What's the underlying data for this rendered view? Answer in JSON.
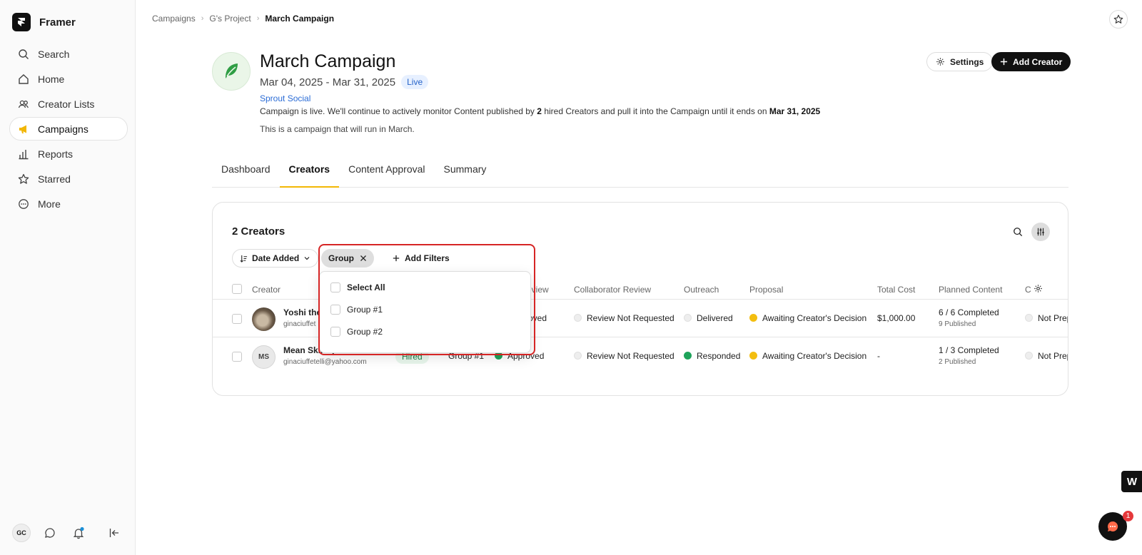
{
  "app": {
    "name": "Framer"
  },
  "nav": [
    {
      "label": "Search",
      "icon": "search-icon"
    },
    {
      "label": "Home",
      "icon": "home-icon"
    },
    {
      "label": "Creator Lists",
      "icon": "users-icon"
    },
    {
      "label": "Campaigns",
      "icon": "megaphone-icon",
      "active": true
    },
    {
      "label": "Reports",
      "icon": "bar-chart-icon"
    },
    {
      "label": "Starred",
      "icon": "star-icon"
    },
    {
      "label": "More",
      "icon": "more-icon"
    }
  ],
  "user": {
    "initials": "GC"
  },
  "breadcrumb": [
    "Campaigns",
    "G's Project",
    "March Campaign"
  ],
  "campaign": {
    "title": "March Campaign",
    "dates": "Mar 04, 2025 - Mar 31, 2025",
    "status": "Live",
    "brand": "Sprout Social",
    "desc_prefix": "Campaign is live. We'll continue to actively monitor Content published by",
    "hired_count": "2",
    "desc_middle": "hired Creators and pull it into the Campaign until it ends on",
    "end_date": "Mar 31, 2025",
    "note": "This is a campaign that will run in March."
  },
  "buttons": {
    "settings": "Settings",
    "add_creator": "Add Creator"
  },
  "tabs": [
    "Dashboard",
    "Creators",
    "Content Approval",
    "Summary"
  ],
  "creators": {
    "count_label": "2 Creators",
    "sort_label": "Date Added",
    "group_chip": "Group",
    "add_filters": "Add Filters",
    "columns": {
      "creator": "Creator",
      "review": "eview",
      "collab": "Collaborator Review",
      "outreach": "Outreach",
      "proposal": "Proposal",
      "cost": "Total Cost",
      "planned": "Planned Content",
      "last": "C"
    },
    "rows": [
      {
        "name": "Yoshi the",
        "email": "ginaciuffet",
        "status": "",
        "group": "",
        "review": "oved",
        "collab": "Review Not Requested",
        "outreach": "Delivered",
        "proposal": "Awaiting Creator's Decision",
        "cost": "$1,000.00",
        "planned": "6 / 6 Completed",
        "published": "9 Published",
        "last": "Not Prep"
      },
      {
        "name": "Mean Skinny Naturals",
        "initials": "MS",
        "email": "ginaciuffetelli@yahoo.com",
        "status": "Hired",
        "group": "Group #1",
        "review": "Approved",
        "collab": "Review Not Requested",
        "outreach": "Responded",
        "proposal": "Awaiting Creator's Decision",
        "cost": "-",
        "planned": "1 / 3 Completed",
        "published": "2 Published",
        "last": "Not Prep"
      }
    ]
  },
  "dropdown": {
    "select_all": "Select All",
    "options": [
      "Group #1",
      "Group #2"
    ]
  },
  "floating": {
    "w_label": "W",
    "chat_badge": "1"
  }
}
